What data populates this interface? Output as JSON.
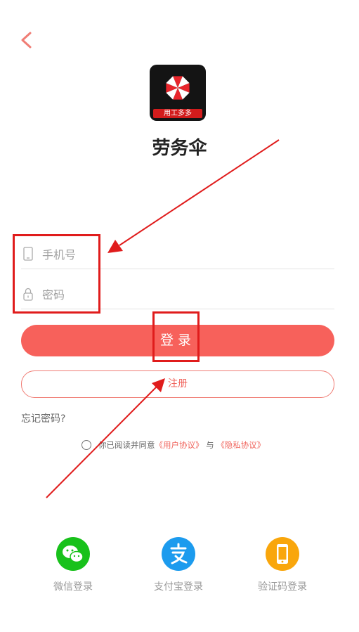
{
  "header": {
    "back_icon": "chevron-left-icon"
  },
  "app": {
    "name": "劳务伞",
    "icon_badge": "用工多多",
    "icon_name": "umbrella-logo-icon"
  },
  "form": {
    "phone_placeholder": "手机号",
    "password_placeholder": "密码",
    "phone_icon": "phone-icon",
    "password_icon": "lock-icon"
  },
  "buttons": {
    "login": "登录",
    "register": "注册",
    "forgot": "忘记密码?"
  },
  "agreement": {
    "prefix": "你已阅读并同意",
    "user_agreement": "《用户协议》",
    "conjunction": "与",
    "privacy_agreement": "《隐私协议》"
  },
  "social": [
    {
      "label": "微信登录",
      "icon": "wechat-icon",
      "color": "#18c11b"
    },
    {
      "label": "支付宝登录",
      "icon": "alipay-icon",
      "color": "#1c9bee"
    },
    {
      "label": "验证码登录",
      "icon": "phone-code-icon",
      "color": "#f9a60c"
    }
  ],
  "colors": {
    "accent": "#f7615b",
    "annotation": "#e01c1c"
  }
}
